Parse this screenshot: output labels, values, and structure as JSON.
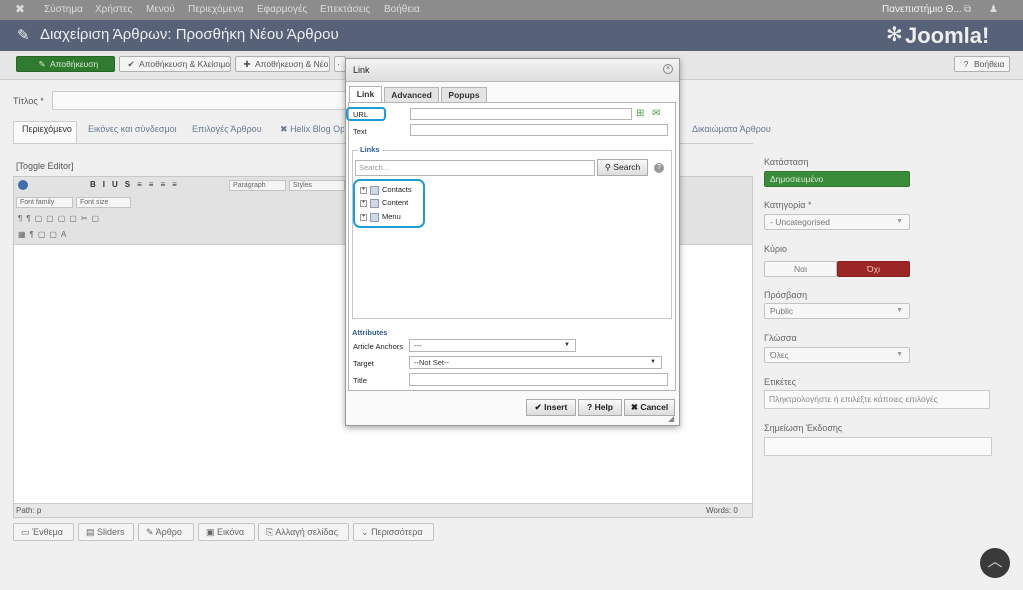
{
  "topnav": {
    "items": [
      "Σύστημα",
      "Χρήστες",
      "Μενού",
      "Περιεχόμενα",
      "Εφαρμογές",
      "Επεκτάσεις",
      "Βοήθεια"
    ],
    "site_user": "Πανεπιστήμιο Θ..."
  },
  "header": {
    "title": "Διαχείριση Άρθρων: Προσθήκη Νέου Άρθρου",
    "logo": "Joomla!"
  },
  "toolbar": {
    "save": "Αποθήκευση",
    "save_close": "Αποθήκευση & Κλείσιμο",
    "save_new": "Αποθήκευση & Νέο",
    "help": "Βοήθεια"
  },
  "form": {
    "title_label": "Τίτλος *",
    "tabs": [
      "Περιεχόμενο",
      "Εικόνες και σύνδεσμοι",
      "Επιλογές Άρθρου",
      "Helix Blog Opt",
      "Δικαιώματα Άρθρου"
    ],
    "toggle_editor": "[Toggle Editor]"
  },
  "editor": {
    "selects": [
      "Paragraph",
      "Styles",
      "Font family",
      "Font size"
    ],
    "path": "Path:  p",
    "words": "Words: 0"
  },
  "bottom_buttons": [
    "Ένθεμα",
    "Sliders",
    "Άρθρο",
    "Εικόνα",
    "Αλλαγή σελίδας",
    "Περισσότερα"
  ],
  "right": {
    "status_label": "Κατάσταση",
    "status_value": "Δημοσιευμένο",
    "category_label": "Κατηγορία *",
    "category_value": "- Uncategorised",
    "featured_label": "Κύριο",
    "yes": "Ναι",
    "no": "Όχι",
    "access_label": "Πρόσβαση",
    "access_value": "Public",
    "language_label": "Γλώσσα",
    "language_value": "Όλες",
    "tags_label": "Ετικέτες",
    "tags_placeholder": "Πληκτρολογήστε ή επιλέξτε κάποιες επιλογές",
    "version_note_label": "Σημείωση Έκδοσης"
  },
  "dialog": {
    "title": "Link",
    "tabs": [
      "Link",
      "Advanced",
      "Popups"
    ],
    "url_label": "URL",
    "text_label": "Text",
    "links_legend": "Links",
    "search_placeholder": "Search...",
    "search_button": "Search",
    "tree": [
      "Contacts",
      "Content",
      "Menu"
    ],
    "attributes": "Attributes",
    "anchors_label": "Article Anchors",
    "anchors_value": "---",
    "target_label": "Target",
    "target_value": "--Not Set--",
    "title_label": "Title",
    "insert": "Insert",
    "help": "Help",
    "cancel": "Cancel"
  },
  "colors": {
    "green": "#2f7a2f",
    "red": "#9b2626",
    "accent": "#1d9dd8"
  }
}
